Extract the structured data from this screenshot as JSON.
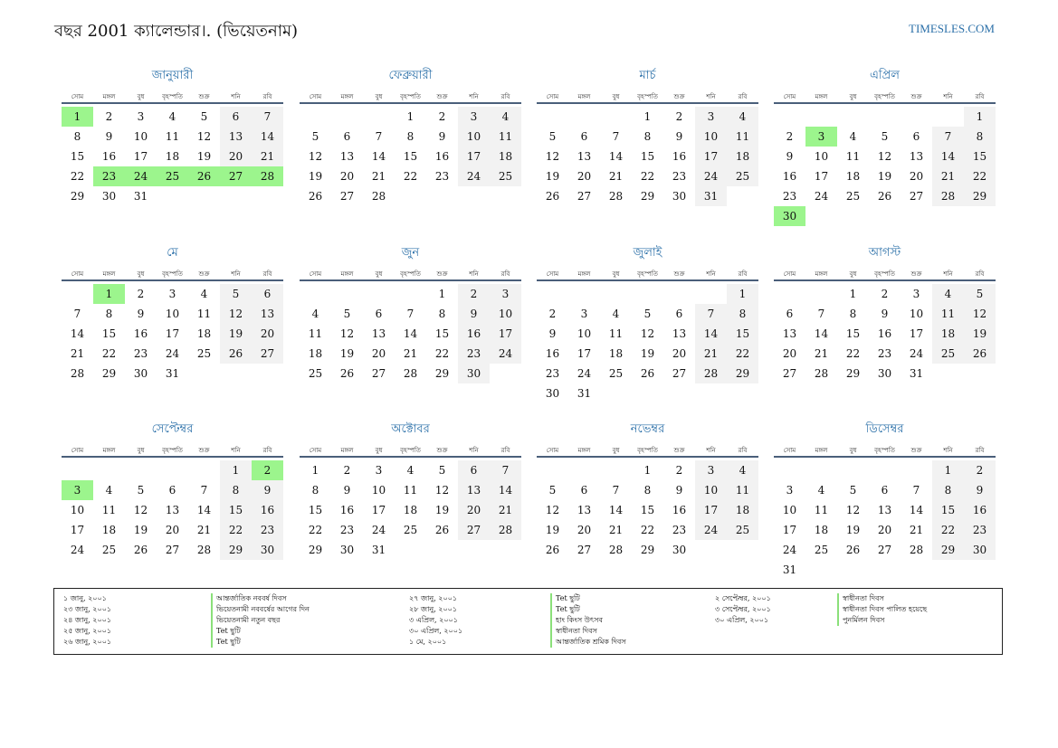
{
  "header": {
    "title": "বছর 2001 ক্যালেন্ডার।. (ভিয়েতনাম)",
    "site": "TIMESLES.COM"
  },
  "weekdays": [
    "সোম",
    "মঙ্গল",
    "বুধ",
    "বৃহস্পতি",
    "শুক্র",
    "শনি",
    "রবি"
  ],
  "months": [
    {
      "name": "জানুয়ারী",
      "days": 31,
      "start": 0,
      "holidays": [
        1,
        23,
        24,
        25,
        26,
        27,
        28
      ]
    },
    {
      "name": "ফেব্রুয়ারী",
      "days": 28,
      "start": 3,
      "holidays": []
    },
    {
      "name": "মার্চ",
      "days": 31,
      "start": 3,
      "holidays": []
    },
    {
      "name": "এপ্রিল",
      "days": 30,
      "start": 6,
      "holidays": [
        3,
        30
      ]
    },
    {
      "name": "মে",
      "days": 31,
      "start": 1,
      "holidays": [
        1
      ]
    },
    {
      "name": "জুন",
      "days": 30,
      "start": 4,
      "holidays": []
    },
    {
      "name": "জুলাই",
      "days": 31,
      "start": 6,
      "holidays": []
    },
    {
      "name": "আগস্ট",
      "days": 31,
      "start": 2,
      "holidays": []
    },
    {
      "name": "সেপ্টেম্বর",
      "days": 30,
      "start": 5,
      "holidays": [
        2,
        3
      ]
    },
    {
      "name": "অক্টোবর",
      "days": 31,
      "start": 0,
      "holidays": []
    },
    {
      "name": "নভেম্বর",
      "days": 30,
      "start": 3,
      "holidays": []
    },
    {
      "name": "ডিসেম্বর",
      "days": 31,
      "start": 5,
      "holidays": []
    }
  ],
  "legend": [
    [
      {
        "date": "১ জানু, ২০০১",
        "name": "আন্তর্জাতিক নববর্ষ দিবস"
      },
      {
        "date": "২৩ জানু, ২০০১",
        "name": "ভিয়েতনামী নববর্ষের আগের দিন"
      },
      {
        "date": "২৪ জানু, ২০০১",
        "name": "ভিয়েতনামী নতুন বছর"
      },
      {
        "date": "২৫ জানু, ২০০১",
        "name": "Tet ছুটি"
      },
      {
        "date": "২৬ জানু, ২০০১",
        "name": "Tet ছুটি"
      }
    ],
    [
      {
        "date": "২৭ জানু, ২০০১",
        "name": "Tet ছুটি"
      },
      {
        "date": "২৮ জানু, ২০০১",
        "name": "Tet ছুটি"
      },
      {
        "date": "৩ এপ্রিল, ২০০১",
        "name": "হাং কিংস উৎসব"
      },
      {
        "date": "৩০ এপ্রিল, ২০০১",
        "name": "স্বাধীনতা দিবস"
      },
      {
        "date": "১ মে, ২০০১",
        "name": "আন্তর্জাতিক শ্রমিক দিবস"
      }
    ],
    [
      {
        "date": "২ সেপ্টেম্বর, ২০০১",
        "name": "স্বাধীনতা দিবস"
      },
      {
        "date": "৩ সেপ্টেম্বর, ২০০১",
        "name": "স্বাধীনতা দিবস পালিত হয়েছে"
      },
      {
        "date": "৩০ এপ্রিল, ২০০১",
        "name": "পুনর্মিলন দিবস"
      }
    ]
  ]
}
